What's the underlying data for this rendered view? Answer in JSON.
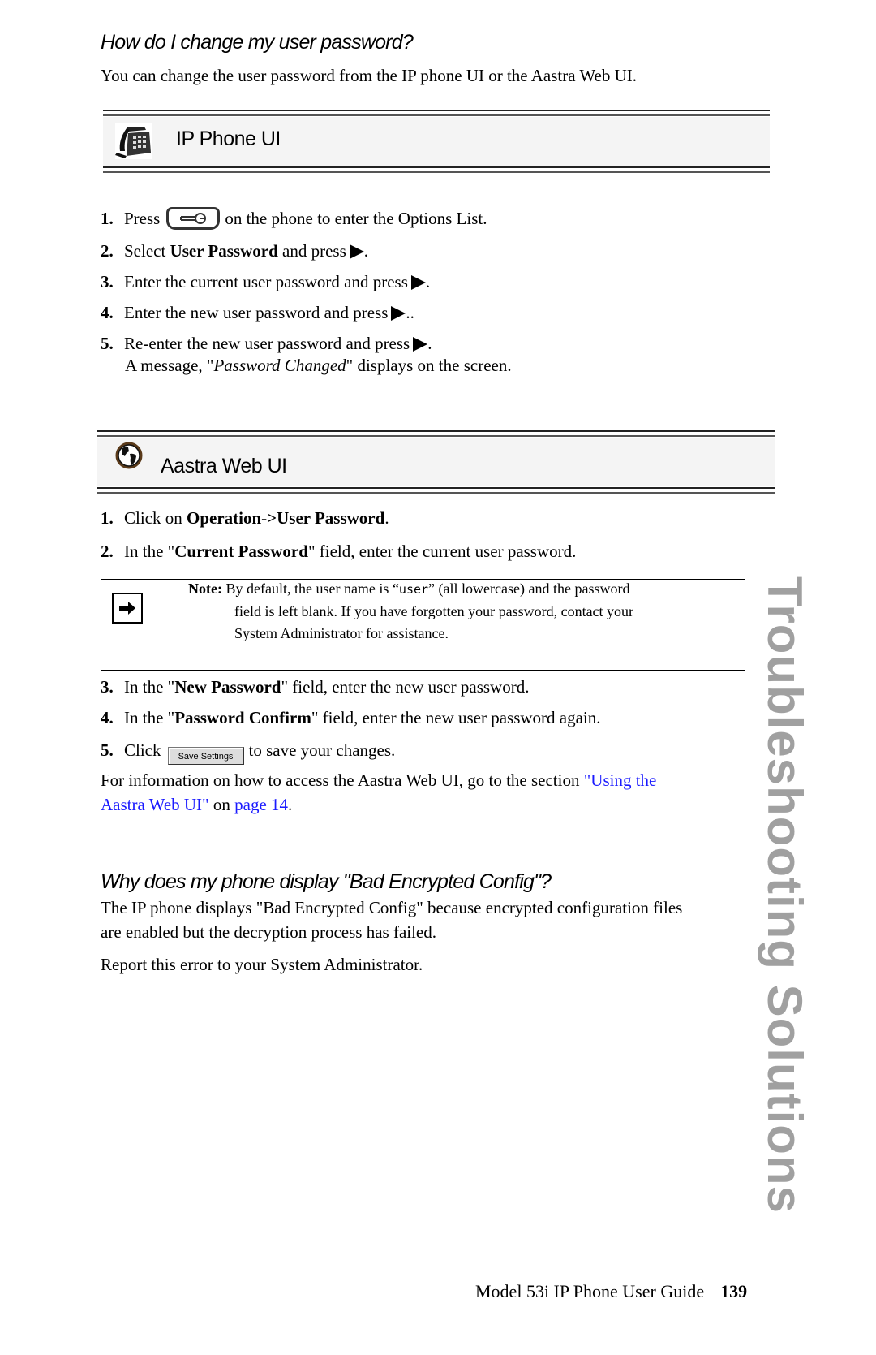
{
  "section1": {
    "title": "How do I change my user password?",
    "intro": "You can change the user password from the IP phone UI or the Aastra Web UI.",
    "ip_phone_banner": {
      "icon": "phone-icon",
      "label": "IP Phone UI"
    },
    "ip_steps": [
      {
        "num": "1.",
        "before": "Press",
        "icon": "options-key-icon",
        "after": "on the phone to enter the Options List."
      },
      {
        "num": "2.",
        "before": "Select ",
        "bold": "User Password",
        "after": " and press",
        "icon": "right-arrow-key-icon",
        "end": "."
      },
      {
        "num": "3.",
        "before": "Enter the current user password and press",
        "icon": "right-arrow-key-icon",
        "end": "."
      },
      {
        "num": "4.",
        "before": "Enter the new user password and press",
        "icon": "right-arrow-key-icon",
        "end": ".."
      },
      {
        "num": "5.",
        "before": "Re-enter the new user password and press",
        "icon": "right-arrow-key-icon",
        "end": "."
      }
    ],
    "ip_result": {
      "before": "A message, \"",
      "italic": "Password Changed",
      "after": "\" displays on the screen."
    },
    "web_banner": {
      "icon": "globe-icon",
      "label": "Aastra Web UI"
    },
    "web_steps": [
      {
        "num": "1.",
        "before": "Click on ",
        "bold": "Operation->User Password",
        "after": "."
      },
      {
        "num": "2.",
        "before": "In the \"",
        "bold": "Current Password",
        "after": "\" field, enter the current user password."
      },
      {
        "num": "3.",
        "before": "In the \"",
        "bold": "New Password",
        "after": "\" field, enter the new user password."
      },
      {
        "num": "4.",
        "before": "In the \"",
        "bold": "Password Confirm",
        "after": "\" field, enter the new user password again."
      },
      {
        "num": "5.",
        "before": "Click",
        "button": "Save Settings",
        "after": "to save your changes."
      }
    ],
    "note": {
      "icon": "arrow-right-icon",
      "label": "Note:",
      "line1_before": "By default, the user name is “",
      "code": "user",
      "line1_after": "” (all lowercase) and the password",
      "line2": "field is left blank. If you have forgotten your password, contact your",
      "line3": "System Administrator for assistance."
    },
    "more_info": {
      "before": "For information on how to access the Aastra Web UI, go to the section ",
      "link1_a": "\"Using the",
      "link1_b": "Aastra Web UI\"",
      "mid": " on ",
      "link2": "page 14",
      "end": "."
    }
  },
  "section2": {
    "title": "Why does my phone display \"Bad Encrypted Config\"?",
    "para1_line1": "The IP phone displays \"Bad Encrypted Config\" because encrypted configuration files",
    "para1_line2": "are enabled but the decryption process has failed.",
    "para2": "Report this error to your System Administrator."
  },
  "side_title": "Troubleshooting Solutions",
  "footer": {
    "guide": "Model 53i IP Phone User Guide",
    "page": "139"
  },
  "colors": {
    "link": "#1a1aff",
    "side_title": "#a0a0a0",
    "banner_fill": "#f4f4f4"
  }
}
